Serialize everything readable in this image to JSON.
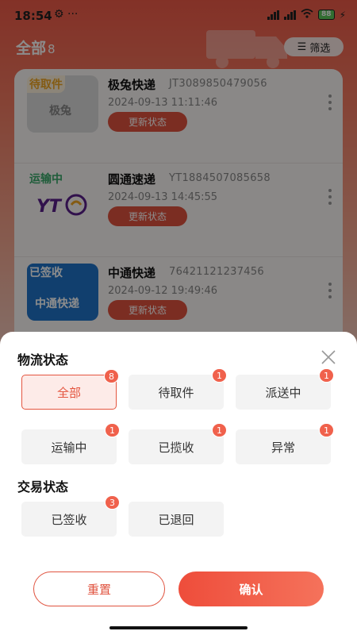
{
  "status_bar": {
    "time": "18:54",
    "left_icons": "⚙ ···",
    "battery": "88"
  },
  "header": {
    "title": "全部",
    "count": "8",
    "filter_label": "筛选"
  },
  "list": [
    {
      "status": "待取件",
      "company": "极兔快递",
      "number": "JT3089850479056",
      "time": "2024-09-13 11:11:46",
      "action": "更新状态",
      "logo_text": "极兔",
      "status_color": "#f0a623"
    },
    {
      "status": "运输中",
      "company": "圆通速递",
      "number": "YT1884507085658",
      "time": "2024-09-13 14:45:55",
      "action": "更新状态",
      "logo_text": "YT",
      "status_color": "#39a96b"
    },
    {
      "status": "已签收",
      "company": "中通快递",
      "number": "76421121237456",
      "time": "2024-09-12 19:49:46",
      "action": "更新状态",
      "logo_text": "中通快递",
      "status_color": "#ffffff"
    }
  ],
  "sheet": {
    "logistics_title": "物流状态",
    "logistics_options": [
      {
        "label": "全部",
        "count": "8",
        "active": true
      },
      {
        "label": "待取件",
        "count": "1",
        "active": false
      },
      {
        "label": "派送中",
        "count": "1",
        "active": false
      },
      {
        "label": "运输中",
        "count": "1",
        "active": false
      },
      {
        "label": "已揽收",
        "count": "1",
        "active": false
      },
      {
        "label": "异常",
        "count": "1",
        "active": false
      }
    ],
    "trade_title": "交易状态",
    "trade_options": [
      {
        "label": "已签收",
        "count": "3",
        "active": false
      },
      {
        "label": "已退回",
        "count": "",
        "active": false
      }
    ],
    "reset_label": "重置",
    "confirm_label": "确认"
  },
  "colors": {
    "accent": "#e0533f",
    "badge": "#f0614c"
  },
  "icons": {
    "close": "close-icon",
    "filter": "menu-lines-icon",
    "more": "more-vertical-icon"
  }
}
